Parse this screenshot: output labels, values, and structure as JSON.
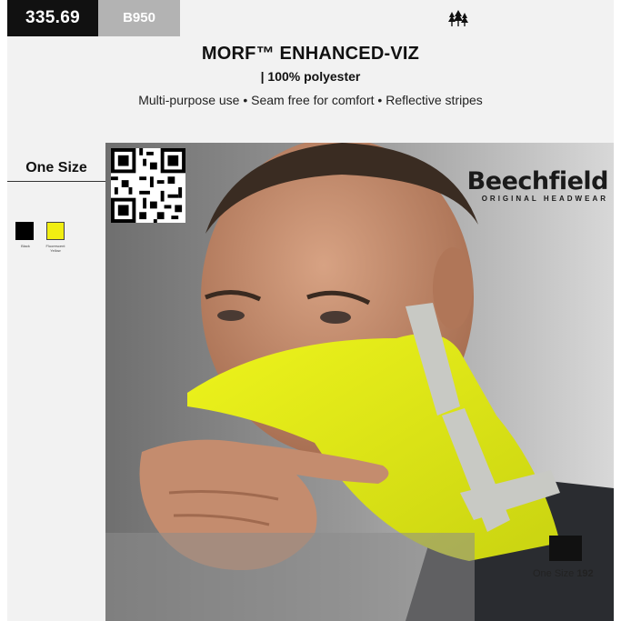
{
  "header": {
    "price": "335.69",
    "code": "B950",
    "title": "MORF™ ENHANCED-VIZ",
    "material": "| 100% polyester",
    "features": "Multi-purpose use • Seam free for comfort • Reflective stripes"
  },
  "sizes": {
    "label": "One Size"
  },
  "colors": [
    {
      "name": "Black",
      "hex": "#000000"
    },
    {
      "name": "Fluorescent Yellow",
      "hex": "#f1ee12"
    }
  ],
  "brand": {
    "name": "Beechfield",
    "tagline": "ORIGINAL HEADWEAR"
  },
  "stock": {
    "size": "One Size",
    "qty": "192"
  },
  "icons": [
    "tree-icon",
    "qr-code"
  ]
}
